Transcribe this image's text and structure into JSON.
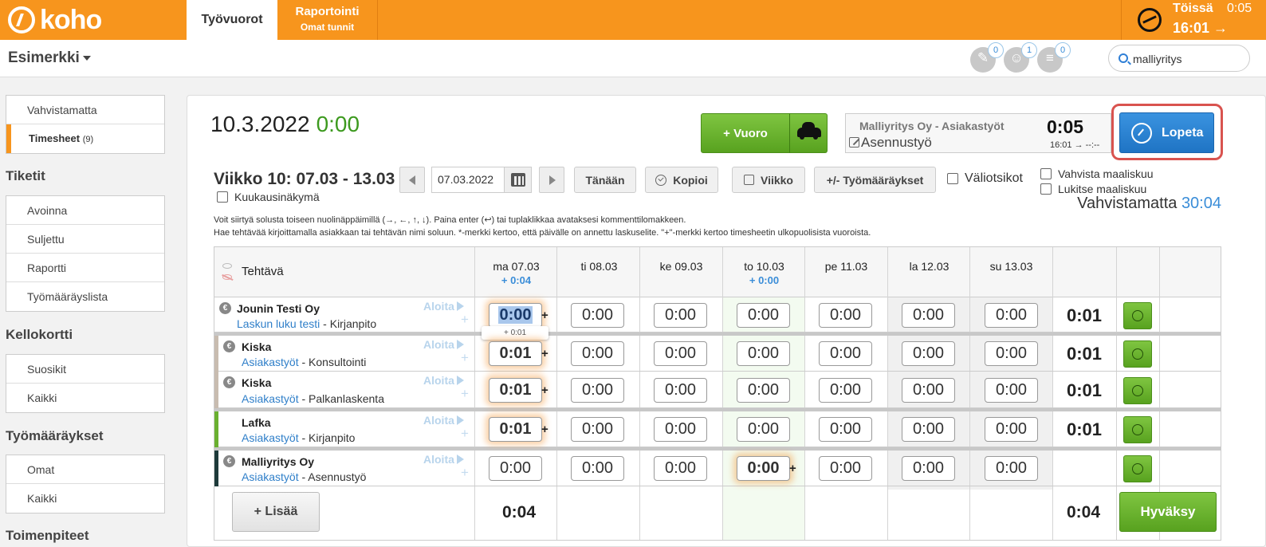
{
  "topbar": {
    "logo": "koho",
    "tabs": [
      {
        "label": "Työvuorot"
      },
      {
        "label": "Raportointi",
        "sub": "Omat tunnit"
      }
    ],
    "clock": {
      "status": "Töissä",
      "elapsed": "0:05",
      "start": "16:01 →"
    }
  },
  "subbar": {
    "company": "Esimerkki",
    "notifications": [
      {
        "icon": "ticket-icon",
        "count": "0"
      },
      {
        "icon": "group-icon",
        "count": "1"
      },
      {
        "icon": "list-icon",
        "count": "0"
      }
    ],
    "search": {
      "value": "malliyritys",
      "placeholder": ""
    }
  },
  "sidebar": {
    "top_items": [
      {
        "label": "Vahvistamatta"
      },
      {
        "label": "Timesheet",
        "count": "(9)"
      }
    ],
    "groups": [
      {
        "title": "Tiketit",
        "items": [
          "Avoinna",
          "Suljettu",
          "Raportti",
          "Työmääräyslista"
        ]
      },
      {
        "title": "Kellokortti",
        "items": [
          "Suosikit",
          "Kaikki"
        ]
      },
      {
        "title": "Työmääräykset",
        "items": [
          "Omat",
          "Kaikki"
        ]
      },
      {
        "title": "Toimenpiteet",
        "items": []
      }
    ]
  },
  "header": {
    "date": "10.3.2022",
    "date_total": "0:00",
    "add_shift": "+ Vuoro",
    "current_task": {
      "customer": "Malliyritys Oy",
      "category": " - Asiakastyöt",
      "task": "Asennustyö",
      "duration": "0:05",
      "range": "16:01 → --:--"
    },
    "stop": "Lopeta"
  },
  "toolbar": {
    "week": "Viikko 10: 07.03 - 13.03",
    "month_view": "Kuukausinäkymä",
    "date_value": "07.03.2022",
    "today": "Tänään",
    "copy": "Kopioi",
    "week_btn": "Viikko",
    "work_orders": "+/- Työmääräykset",
    "subtotals": "Väliotsikot",
    "confirm_invoice": "Vahvista maaliskuu",
    "lock_invoice": "Lukitse maaliskuu",
    "unconfirmed_label": "Vahvistamatta",
    "unconfirmed_value": "30:04"
  },
  "help": {
    "line1": "Voit siirtyä solusta toiseen nuolinäppäimillä (→, ←, ↑, ↓). Paina enter (↩) tai tuplaklikkaa avataksesi kommenttilomakkeen.",
    "line2": "Hae tehtävää kirjoittamalla asiakkaan tai tehtävän nimi soluun. *-merkki kertoo, että päivälle on annettu laskuselite. \"+\"-merkki kertoo timesheetin ulkopuolisista vuoroista."
  },
  "grid": {
    "task_header": "Tehtävä",
    "days": [
      {
        "label": "ma 07.03",
        "sub": "+ 0:04"
      },
      {
        "label": "ti 08.03",
        "sub": ""
      },
      {
        "label": "ke 09.03",
        "sub": ""
      },
      {
        "label": "to 10.03",
        "sub": "+ 0:00"
      },
      {
        "label": "pe 11.03",
        "sub": ""
      },
      {
        "label": "la 12.03",
        "sub": ""
      },
      {
        "label": "su 13.03",
        "sub": ""
      }
    ],
    "start_label": "Aloita",
    "rows": [
      {
        "customer": "Jounin Testi Oy",
        "category": "Laskun luku testi",
        "task": " - Kirjanpito",
        "cells": [
          "0:00",
          "0:00",
          "0:00",
          "0:00",
          "0:00",
          "0:00",
          "0:00"
        ],
        "total": "0:01",
        "tip": "+ 0:01"
      },
      {
        "customer": "Kiska",
        "category": "Asiakastyöt",
        "task": " - Konsultointi",
        "cells": [
          "0:01",
          "0:00",
          "0:00",
          "0:00",
          "0:00",
          "0:00",
          "0:00"
        ],
        "total": "0:01"
      },
      {
        "customer": "Kiska",
        "category": "Asiakastyöt",
        "task": " - Palkanlaskenta",
        "cells": [
          "0:01",
          "0:00",
          "0:00",
          "0:00",
          "0:00",
          "0:00",
          "0:00"
        ],
        "total": "0:01"
      },
      {
        "customer": "Lafka",
        "category": "Asiakastyöt",
        "task": " - Kirjanpito",
        "cells": [
          "0:01",
          "0:00",
          "0:00",
          "0:00",
          "0:00",
          "0:00",
          "0:00"
        ],
        "total": "0:01"
      },
      {
        "customer": "Malliyritys Oy",
        "category": "Asiakastyöt",
        "task": " - Asennustyö",
        "cells": [
          "0:00",
          "0:00",
          "0:00",
          "0:00",
          "0:00",
          "0:00",
          "0:00"
        ],
        "total": ""
      }
    ],
    "add": "+ Lisää",
    "day_total": "0:04",
    "grand_total": "0:04",
    "approve_all": "Hyväksy"
  },
  "colors": {
    "brand": "#f7951d",
    "green": "#58a21f",
    "blue": "#1f74c4",
    "link": "#2f7fc9"
  }
}
